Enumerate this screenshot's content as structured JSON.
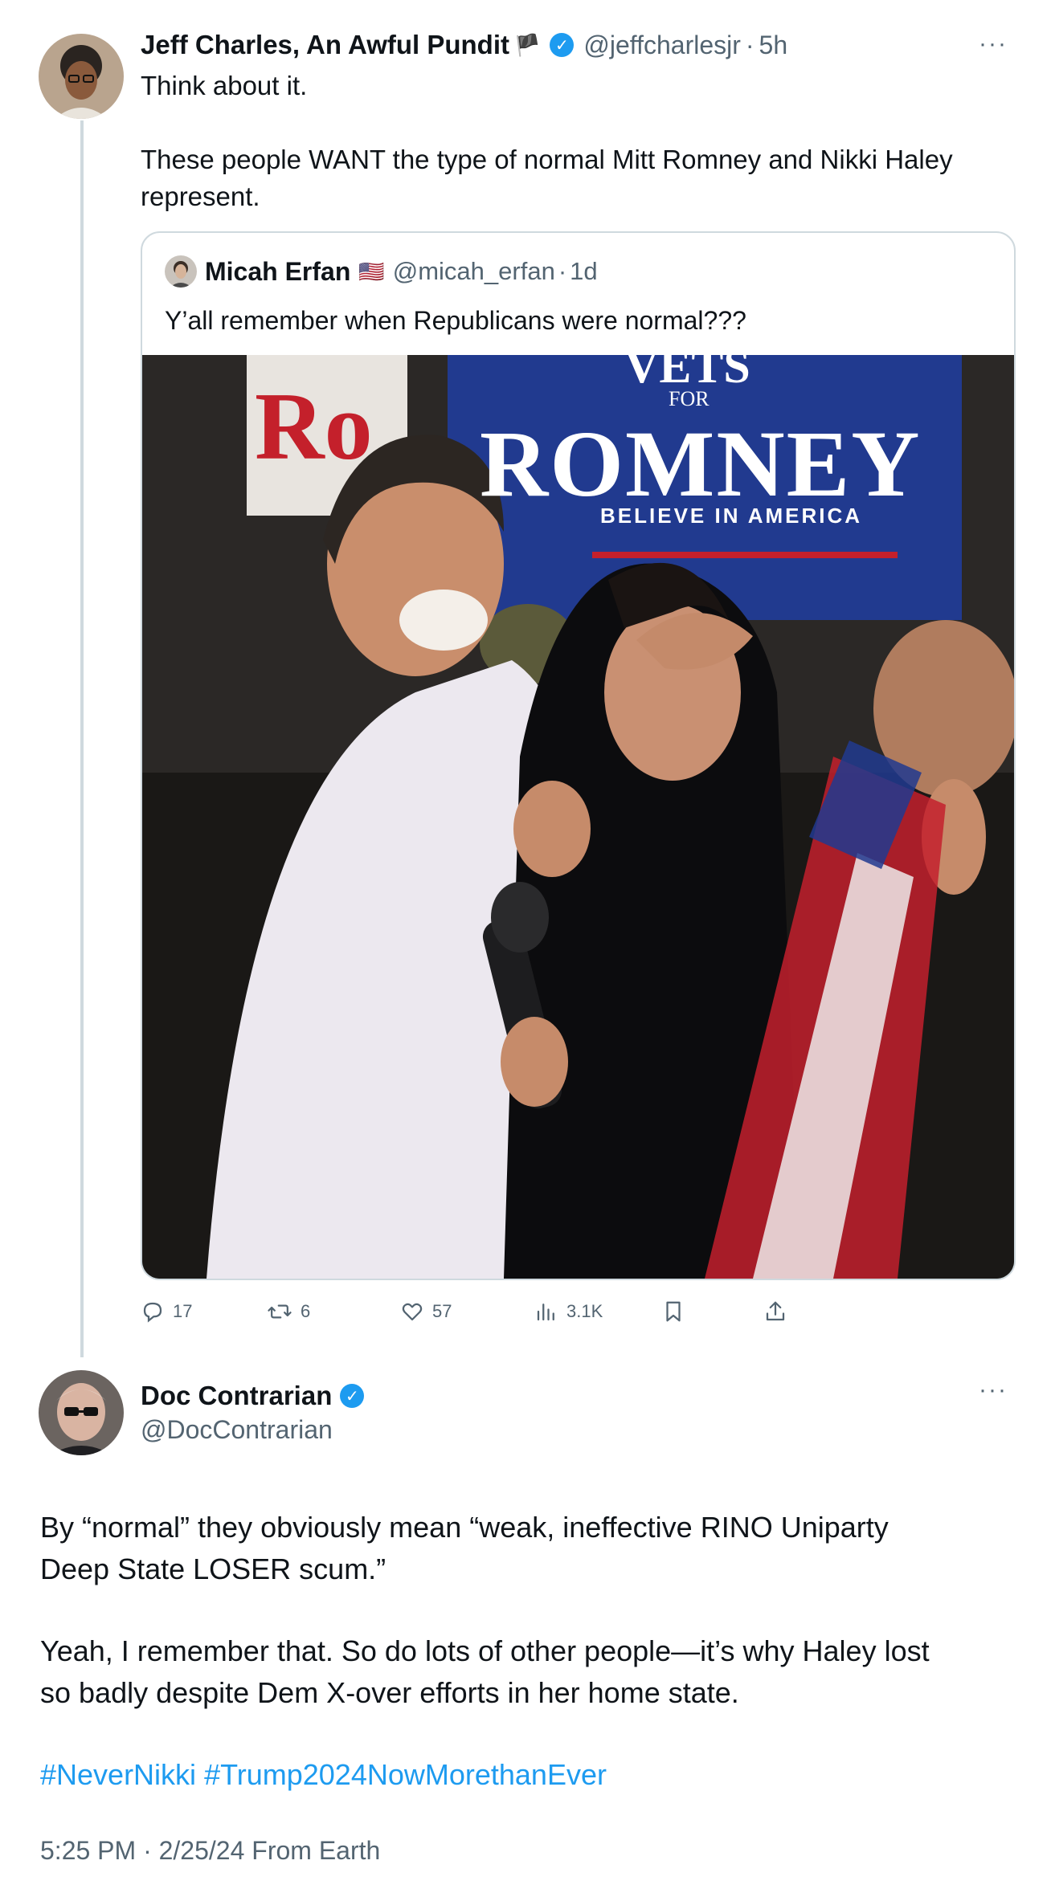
{
  "main_tweet": {
    "author_name": "Jeff Charles, An Awful Pundit",
    "flag_emoji": "🏴",
    "handle": "@jeffcharlesjr",
    "sep": "·",
    "time": "5h",
    "text_line1": "Think about it.",
    "text_line2": "These people WANT the type of normal Mitt Romney and Nikki Haley",
    "text_line3": "represent.",
    "more_icon": "more-dots-icon"
  },
  "quoted_tweet": {
    "author_name": "Micah Erfan",
    "flag_emoji": "🇺🇸",
    "handle": "@micah_erfan",
    "sep": "·",
    "time": "1d",
    "text": "Y’all remember when Republicans were normal???",
    "image": {
      "sign_top": "VETS",
      "sign_for": "FOR",
      "sign_main": "ROMNEY",
      "sign_sub": "BELIEVE IN AMERICA",
      "sign_left_fragment": "Ro"
    }
  },
  "actions": {
    "replies": "17",
    "reposts": "6",
    "likes": "57",
    "views": "3.1K"
  },
  "reply_tweet": {
    "author_name": "Doc Contrarian",
    "handle": "@DocContrarian",
    "para1_line1": "By “normal” they obviously mean “weak, ineffective RINO Uniparty",
    "para1_line2": "Deep State LOSER scum.”",
    "para2_line1": "Yeah, I remember that. So do lots of other people—it’s why Haley lost",
    "para2_line2": "so badly despite Dem X-over efforts in her home state.",
    "hashtag1": "#NeverNikki",
    "hashtag2": "#Trump2024NowMorethanEver",
    "timestamp": "5:25 PM · 2/25/24 From Earth"
  },
  "colors": {
    "accent": "#1d9bf0",
    "muted": "#536471",
    "border": "#cfd9de"
  }
}
